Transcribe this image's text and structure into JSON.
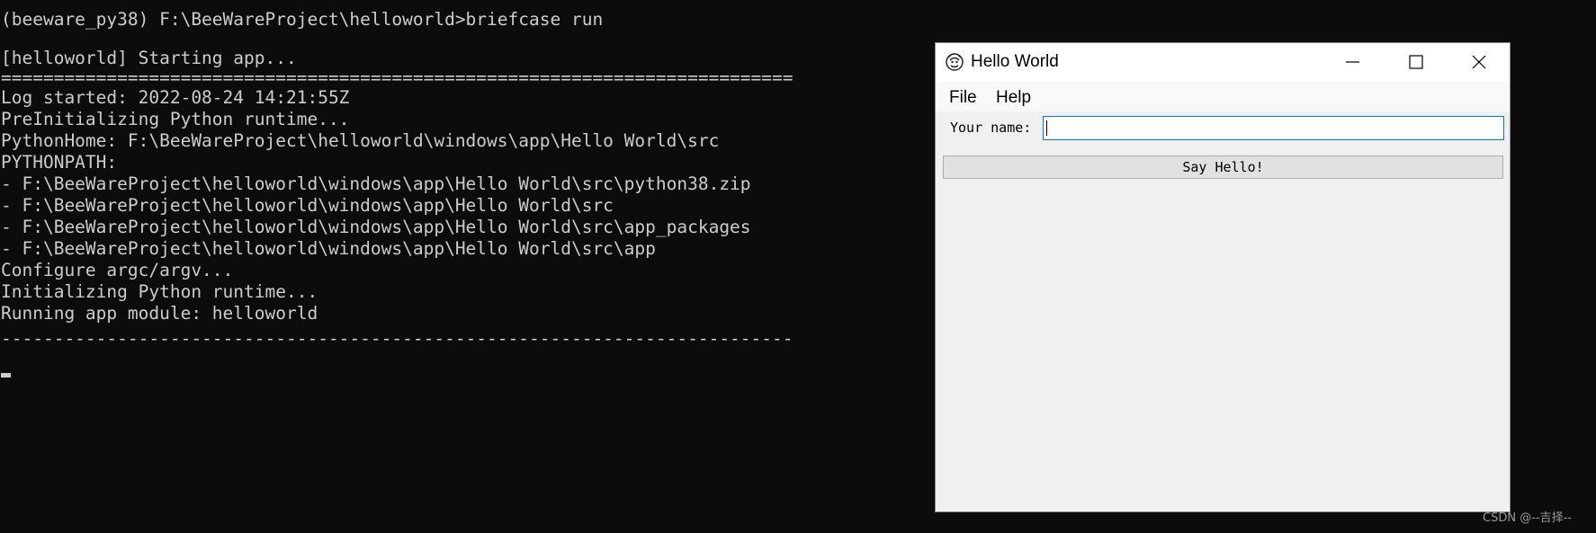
{
  "terminal": {
    "command_line": "(beeware_py38) F:\\BeeWareProject\\helloworld>briefcase run",
    "lines": [
      "[helloworld] Starting app...",
      "===========================================================================",
      "Log started: 2022-08-24 14:21:55Z",
      "PreInitializing Python runtime...",
      "PythonHome: F:\\BeeWareProject\\helloworld\\windows\\app\\Hello World\\src",
      "PYTHONPATH:",
      "- F:\\BeeWareProject\\helloworld\\windows\\app\\Hello World\\src\\python38.zip",
      "- F:\\BeeWareProject\\helloworld\\windows\\app\\Hello World\\src",
      "- F:\\BeeWareProject\\helloworld\\windows\\app\\Hello World\\src\\app_packages",
      "- F:\\BeeWareProject\\helloworld\\windows\\app\\Hello World\\src\\app",
      "Configure argc/argv...",
      "Initializing Python runtime...",
      "Running app module: helloworld",
      "---------------------------------------------------------------------------"
    ],
    "colors": {
      "background": "#0c0c0c",
      "text": "#cccccc"
    }
  },
  "window": {
    "title": "Hello World",
    "menu": [
      "File",
      "Help"
    ],
    "controls": {
      "minimize_icon": "minimize-icon",
      "maximize_icon": "maximize-icon",
      "close_icon": "close-icon"
    },
    "form": {
      "name_label": "Your name:",
      "name_value": "",
      "button_label": "Say Hello!"
    },
    "colors": {
      "focus_border": "#0078d7",
      "window_background": "#f0f0f0"
    }
  },
  "watermark": "CSDN @--吉择--"
}
